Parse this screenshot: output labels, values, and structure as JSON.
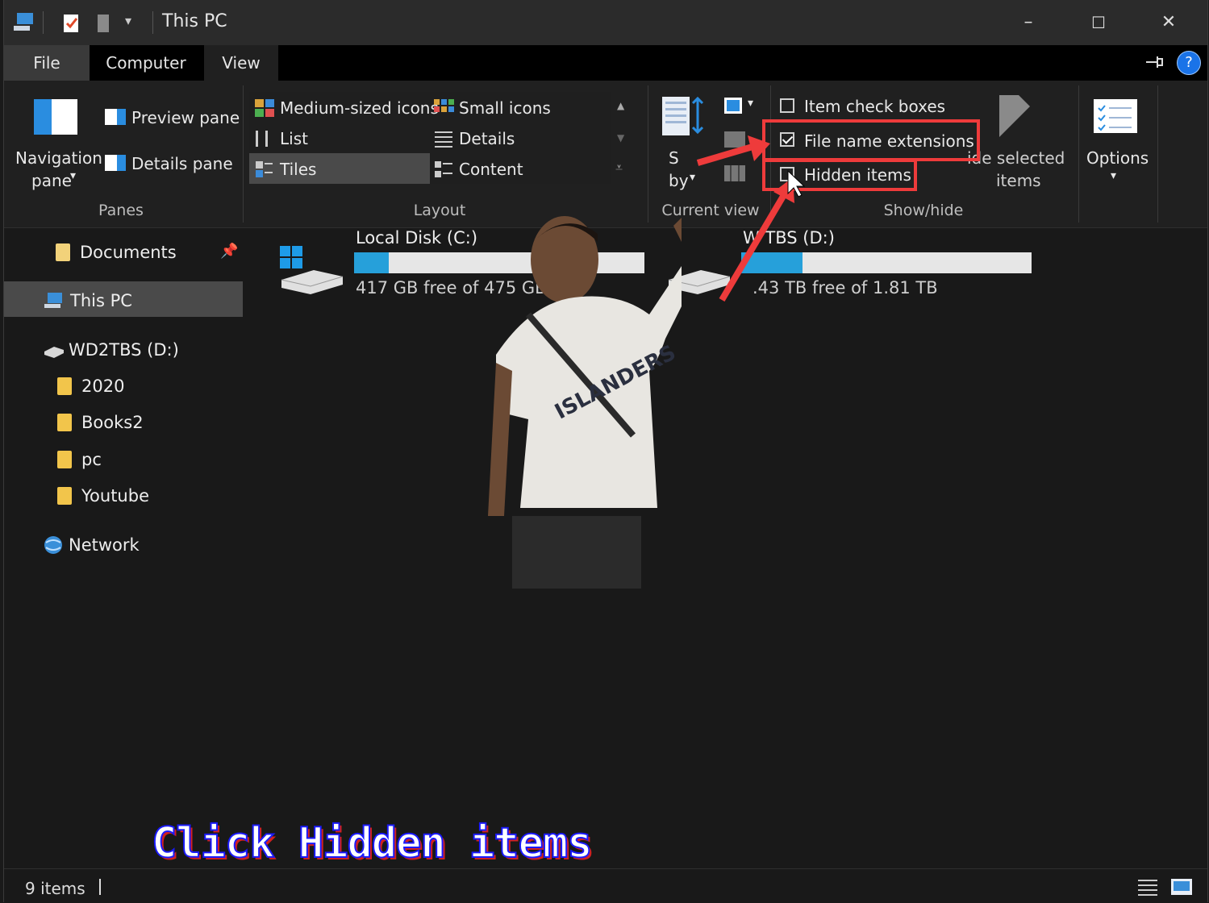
{
  "window": {
    "title": "This PC",
    "controls": {
      "minimize": "–",
      "maximize": "☐",
      "close": "✕"
    }
  },
  "tabs": {
    "file": "File",
    "computer": "Computer",
    "view": "View"
  },
  "help_label": "?",
  "ribbon": {
    "panes": {
      "navigation_pane_line1": "Navigation",
      "navigation_pane_line2": "pane",
      "preview_pane": "Preview pane",
      "details_pane": "Details pane",
      "group_label": "Panes"
    },
    "layout": {
      "items": [
        "Medium-sized icons",
        "Small icons",
        "List",
        "Details",
        "Tiles",
        "Content"
      ],
      "selected": "Tiles",
      "group_label": "Layout"
    },
    "current_view": {
      "sort_line1": "S",
      "sort_line2": "by",
      "group_label": "Current view"
    },
    "show_hide": {
      "item_check_boxes": "Item check boxes",
      "file_name_extensions": "File name extensions",
      "hidden_items": "Hidden items",
      "hide_selected_line1": "ide selected",
      "hide_selected_line2": "items",
      "group_label": "Show/hide",
      "checked": {
        "item_check_boxes": false,
        "file_name_extensions": true,
        "hidden_items": false
      }
    },
    "options": {
      "label": "Options"
    }
  },
  "nav": {
    "items": [
      {
        "label": "Documents",
        "icon": "documents-icon"
      },
      {
        "label": "This PC",
        "icon": "this-pc-icon"
      },
      {
        "label": "WD2TBS (D:)",
        "icon": "drive-icon"
      },
      {
        "label": "2020",
        "icon": "folder-icon"
      },
      {
        "label": "Books2",
        "icon": "folder-icon"
      },
      {
        "label": "pc",
        "icon": "folder-icon"
      },
      {
        "label": "Youtube",
        "icon": "folder-icon"
      },
      {
        "label": "Network",
        "icon": "network-icon"
      }
    ]
  },
  "drives": [
    {
      "name": "Local Disk (C:)",
      "free": "417 GB free of 475 GB",
      "used_fraction": 0.12
    },
    {
      "name": "W    TBS (D:)",
      "free": ".43 TB free of 1.81 TB",
      "used_fraction": 0.21
    }
  ],
  "status": {
    "items": "9 items"
  },
  "caption": "Click Hidden items",
  "colors": {
    "accent": "#26a0da",
    "highlight": "#ee3b3b",
    "folder": "#f2c54b"
  }
}
